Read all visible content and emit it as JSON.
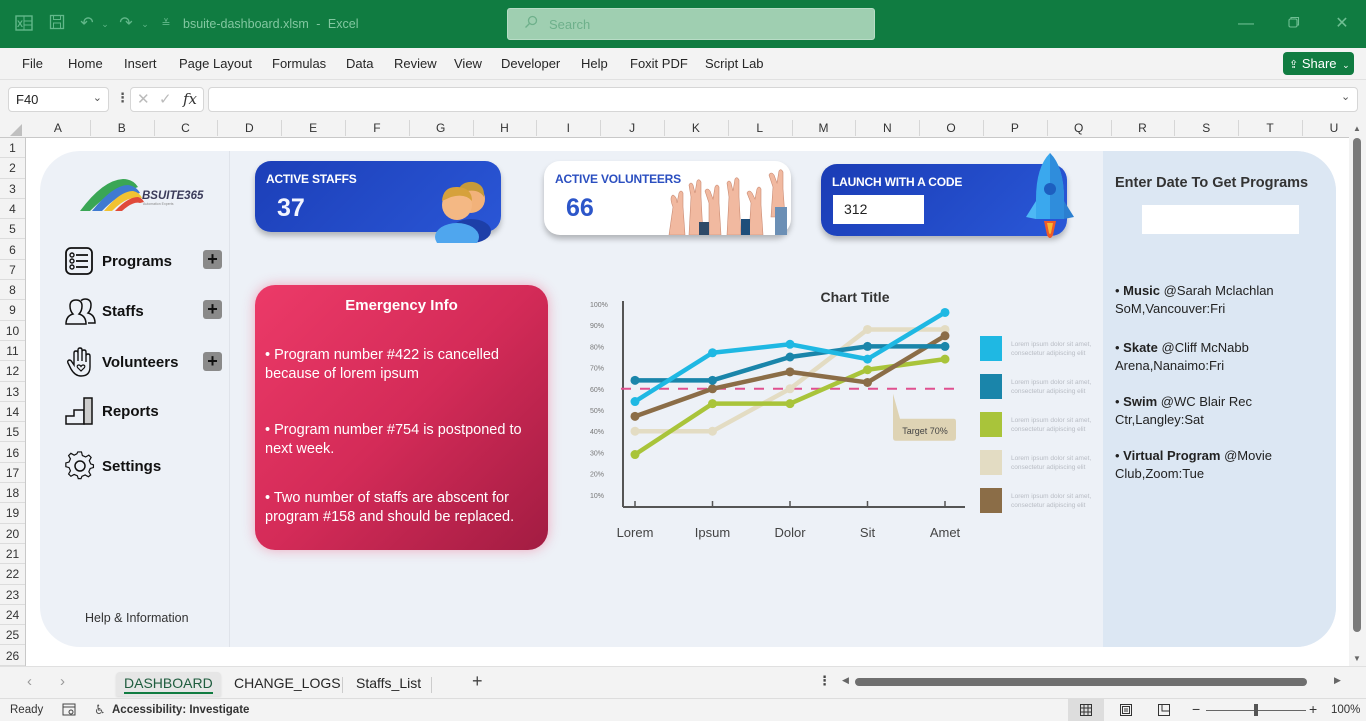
{
  "window": {
    "file_title": "bsuite-dashboard.xlsm",
    "separator": "-",
    "app_name": "Excel",
    "search_placeholder": "Search"
  },
  "ribbon": {
    "tabs": [
      "File",
      "Home",
      "Insert",
      "Page Layout",
      "Formulas",
      "Data",
      "Review",
      "View",
      "Developer",
      "Help",
      "Foxit PDF",
      "Script Lab"
    ],
    "share_label": "Share"
  },
  "formula_bar": {
    "name_box": "F40",
    "fx_label": "fx",
    "formula_value": ""
  },
  "grid": {
    "columns": [
      "A",
      "B",
      "C",
      "D",
      "E",
      "F",
      "G",
      "H",
      "I",
      "J",
      "K",
      "L",
      "M",
      "N",
      "O",
      "P",
      "Q",
      "R",
      "S",
      "T",
      "U"
    ],
    "rows": [
      "1",
      "2",
      "3",
      "4",
      "5",
      "6",
      "7",
      "8",
      "9",
      "10",
      "11",
      "12",
      "13",
      "14",
      "15",
      "16",
      "17",
      "18",
      "19",
      "20",
      "21",
      "22",
      "23",
      "24",
      "25",
      "26"
    ]
  },
  "sidebar": {
    "logo_text": "BSUITE365",
    "logo_sub": "Automation Experts",
    "items": [
      {
        "label": "Programs",
        "icon": "list-icon",
        "has_add": true
      },
      {
        "label": "Staffs",
        "icon": "users-icon",
        "has_add": true
      },
      {
        "label": "Volunteers",
        "icon": "hand-heart-icon",
        "has_add": true
      },
      {
        "label": "Reports",
        "icon": "bar-steps-icon",
        "has_add": false
      },
      {
        "label": "Settings",
        "icon": "gear-icon",
        "has_add": false
      }
    ],
    "add_symbol": "+",
    "help_label": "Help & Information"
  },
  "cards": {
    "active_staffs": {
      "title": "ACTIVE STAFFS",
      "value": "37"
    },
    "active_volunteers": {
      "title": "ACTIVE VOLUNTEERS",
      "value": "66"
    },
    "launch_code": {
      "title": "LAUNCH WITH A CODE",
      "value": "312"
    }
  },
  "emergency": {
    "title": "Emergency Info",
    "items": [
      "• Program number #422 is cancelled because of lorem ipsum",
      "• Program number #754 is postponed to next week.",
      "• Two number of staffs are abscent for program #158 and should be replaced."
    ]
  },
  "chart_data": {
    "type": "line",
    "title": "Chart Title",
    "categories": [
      "Lorem",
      "Ipsum",
      "Dolor",
      "Sit",
      "Amet"
    ],
    "y_ticks": [
      "10%",
      "20%",
      "30%",
      "40%",
      "50%",
      "60%",
      "70%",
      "80%",
      "90%",
      "100%"
    ],
    "ylim": [
      0,
      100
    ],
    "xlabel": "",
    "ylabel": "",
    "grid": false,
    "legend_position": "right",
    "target_line": {
      "value": 60,
      "label": "Target 70%",
      "color": "#e0508f"
    },
    "series": [
      {
        "name": "Lorem ipsum dolor sit amet, consectetur adipiscing elit",
        "color": "#1fb8e3",
        "values": [
          54,
          77,
          81,
          74,
          96
        ]
      },
      {
        "name": "Lorem ipsum dolor sit amet, consectetur adipiscing elit",
        "color": "#1a85aa",
        "values": [
          64,
          64,
          75,
          80,
          80
        ]
      },
      {
        "name": "Lorem ipsum dolor sit amet, consectetur adipiscing elit",
        "color": "#a9c43a",
        "values": [
          29,
          53,
          53,
          69,
          74
        ]
      },
      {
        "name": "Lorem ipsum dolor sit amet, consectetur adipiscing elit",
        "color": "#e3dcc3",
        "values": [
          40,
          40,
          60,
          88,
          88
        ]
      },
      {
        "name": "Lorem ipsum dolor sit amet, consectetur adipiscing elit",
        "color": "#8b6d47",
        "values": [
          47,
          60,
          68,
          63,
          85
        ]
      }
    ]
  },
  "programs_panel": {
    "title": "Enter Date To Get Programs",
    "date_value": "",
    "items": [
      {
        "name": "Music",
        "detail": "@Sarah Mclachlan SoM,Vancouver:Fri"
      },
      {
        "name": "Skate",
        "detail": "@Cliff McNabb Arena,Nanaimo:Fri"
      },
      {
        "name": "Swim",
        "detail": "@WC Blair Rec Ctr,Langley:Sat"
      },
      {
        "name": "Virtual Program",
        "detail": "@Movie Club,Zoom:Tue"
      }
    ]
  },
  "sheet_tabs": {
    "tabs": [
      "DASHBOARD",
      "CHANGE_LOGS",
      "Staffs_List"
    ],
    "active": "DASHBOARD",
    "add_label": "+"
  },
  "status_bar": {
    "ready": "Ready",
    "accessibility": "Accessibility: Investigate",
    "zoom": "100%",
    "zoom_fraction": 0.5
  },
  "colors": {
    "excel_green": "#107c41",
    "card_blue": "#1f46c4",
    "emergency_red": "#d42b58"
  }
}
